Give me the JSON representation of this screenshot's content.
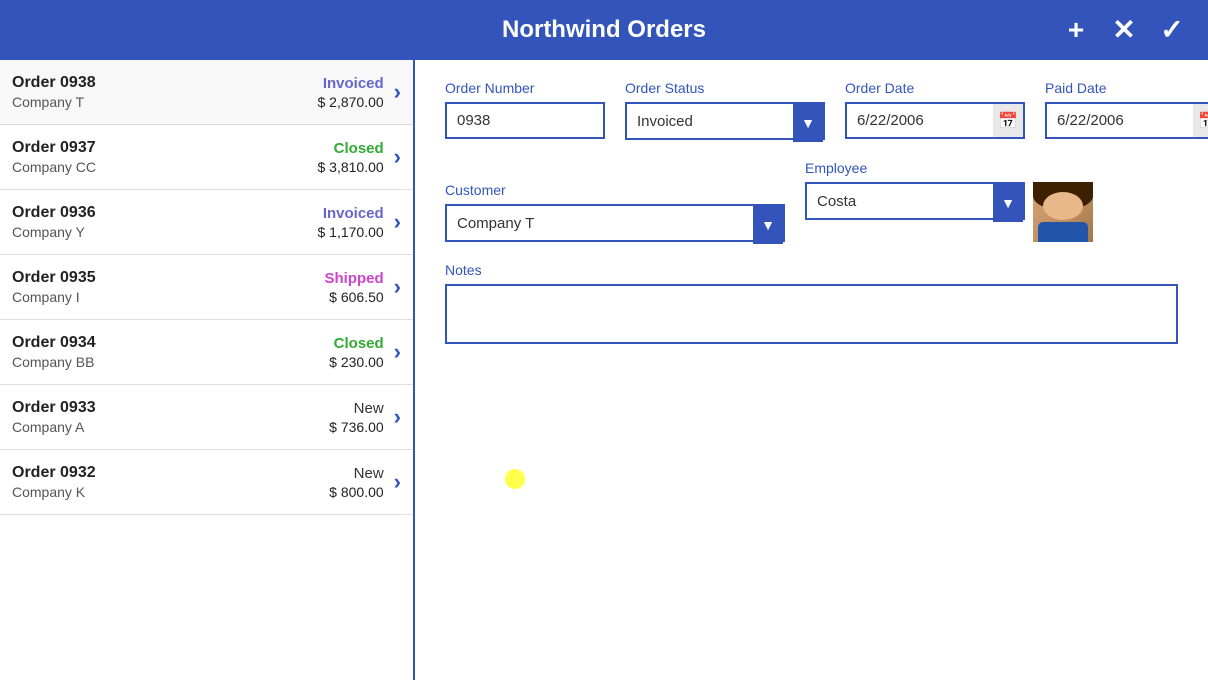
{
  "header": {
    "title": "Northwind Orders",
    "add_label": "+",
    "close_label": "✕",
    "check_label": "✓"
  },
  "orders": [
    {
      "number": "Order 0938",
      "company": "Company T",
      "status": "Invoiced",
      "status_class": "status-invoiced",
      "amount": "$ 2,870.00",
      "active": true
    },
    {
      "number": "Order 0937",
      "company": "Company CC",
      "status": "Closed",
      "status_class": "status-closed",
      "amount": "$ 3,810.00",
      "active": false
    },
    {
      "number": "Order 0936",
      "company": "Company Y",
      "status": "Invoiced",
      "status_class": "status-invoiced",
      "amount": "$ 1,170.00",
      "active": false
    },
    {
      "number": "Order 0935",
      "company": "Company I",
      "status": "Shipped",
      "status_class": "status-shipped",
      "amount": "$ 606.50",
      "active": false
    },
    {
      "number": "Order 0934",
      "company": "Company BB",
      "status": "Closed",
      "status_class": "status-closed",
      "amount": "$ 230.00",
      "active": false
    },
    {
      "number": "Order 0933",
      "company": "Company A",
      "status": "New",
      "status_class": "status-new",
      "amount": "$ 736.00",
      "active": false
    },
    {
      "number": "Order 0932",
      "company": "Company K",
      "status": "New",
      "status_class": "status-new",
      "amount": "$ 800.00",
      "active": false
    }
  ],
  "detail": {
    "order_number_label": "Order Number",
    "order_number_value": "0938",
    "order_status_label": "Order Status",
    "order_status_value": "Invoiced",
    "order_date_label": "Order Date",
    "order_date_value": "6/22/2006",
    "paid_date_label": "Paid Date",
    "paid_date_value": "6/22/2006",
    "customer_label": "Customer",
    "customer_value": "Company T",
    "employee_label": "Employee",
    "employee_value": "Costa",
    "notes_label": "Notes",
    "notes_value": ""
  },
  "colors": {
    "primary": "#3355bb",
    "invoiced": "#6666cc",
    "closed": "#33aa33",
    "shipped": "#cc44cc"
  }
}
